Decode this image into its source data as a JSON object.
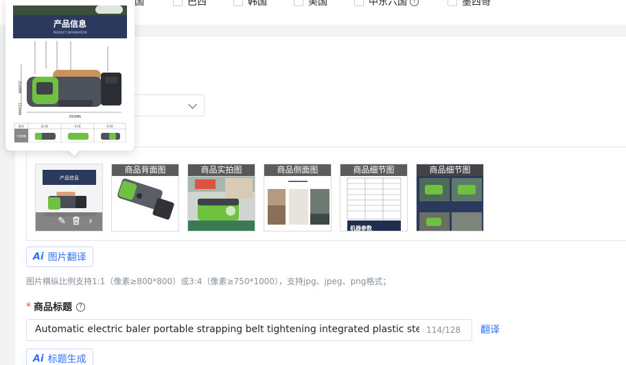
{
  "countries": [
    {
      "label": "美国"
    },
    {
      "label": "巴西"
    },
    {
      "label": "韩国"
    },
    {
      "label": "美国"
    },
    {
      "label": "中东六国"
    },
    {
      "label": "墨西哥"
    }
  ],
  "preview": {
    "title": "产品信息",
    "subtitle": "PRODUCT INFORMATION",
    "dim_height": "250MM",
    "dim_height2": "110MM",
    "dim_width": "350MN",
    "table_cols": [
      "型号",
      "Q-16",
      "S-16",
      "S-16"
    ],
    "table_row_label": "产品规格"
  },
  "images": {
    "thumbnails": [
      {
        "label": ""
      },
      {
        "label": "商品背面图"
      },
      {
        "label": "商品实拍图"
      },
      {
        "label": "商品侧面图"
      },
      {
        "label": "商品细节图",
        "footer": "机器参数"
      },
      {
        "label": "商品细节图"
      }
    ],
    "translate_button": "图片翻译",
    "hint": "图片横纵比例支持1:1（像素≥800*800）或3:4（像素≥750*1000），支持jpg、jpeg、png格式；"
  },
  "title_field": {
    "required_mark": "*",
    "label": "商品标题",
    "help_icon": "?",
    "value": "Automatic electric baler portable strapping belt tightening integrated plastic steel belt plast",
    "counter": "114/128",
    "translate_link": "翻译",
    "generate_button": "标题生成"
  },
  "icons": {
    "ai": "Ai",
    "edit": "✎",
    "trash": "🗑",
    "next": "›"
  },
  "colors": {
    "accent": "#3370ff",
    "required": "#f53f3f",
    "device_green": "#6fc23f",
    "banner_navy": "#2b3a5c"
  }
}
